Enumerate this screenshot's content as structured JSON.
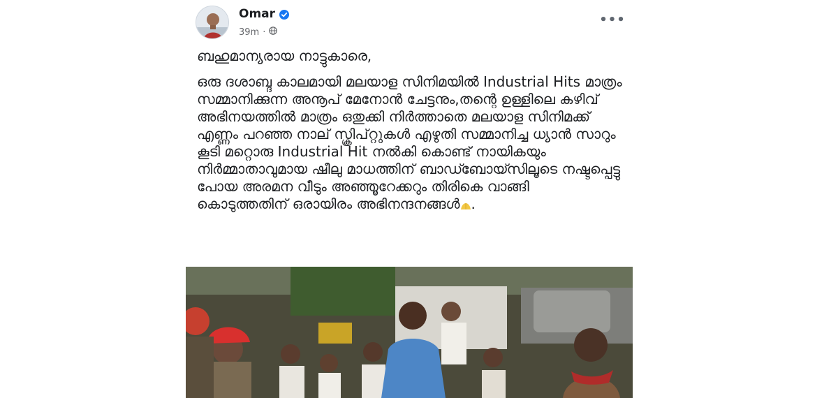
{
  "post": {
    "author": "Omar",
    "time": "39m",
    "dot": "·",
    "more_label": "•••",
    "greeting": "ബഹുമാന്യരായ നാട്ടുകാരെ,",
    "body": "ഒരു ദശാബ്ദ കാലമായി മലയാള സിനിമയിൽ Industrial Hits മാത്രം സമ്മാനിക്കുന്ന  അനൂപ് മേനോൻ ചേട്ടനും,തന്റെ ഉള്ളിലെ കഴിവ് അഭിനയത്തിൽ മാത്രം ഒതുക്കി നിർത്താതെ മലയാള സിനിമക്ക് എണ്ണം പറഞ്ഞ നാല് സ്ക്രിപ്റ്റുകൾ എഴുതി സമ്മാനിച്ച ധ്യാൻ സാറും കൂടി മറ്റൊരു Industrial Hit നൽകി കൊണ്ട് നായികയും നിർമ്മാതാവുമായ ഷീലു മാധത്തിന് ബാഡ്ബോയ്സിലൂടെ നഷ്ടപ്പെട്ടു പോയ അരമന വീടും അഞ്ഞൂറേക്കറും തിരികെ വാങ്ങി കൊടുത്തതിന് ഒരായിരം അഭിനന്ദനങ്ങൾ",
    "body_end": ".",
    "icons": {
      "verified": "verified-badge-icon",
      "audience": "globe-icon",
      "more": "more-options-icon",
      "emoji": "folded-hands-icon"
    },
    "colors": {
      "verified": "#1877f2",
      "text": "#1c1e21",
      "meta": "#65676b"
    }
  }
}
